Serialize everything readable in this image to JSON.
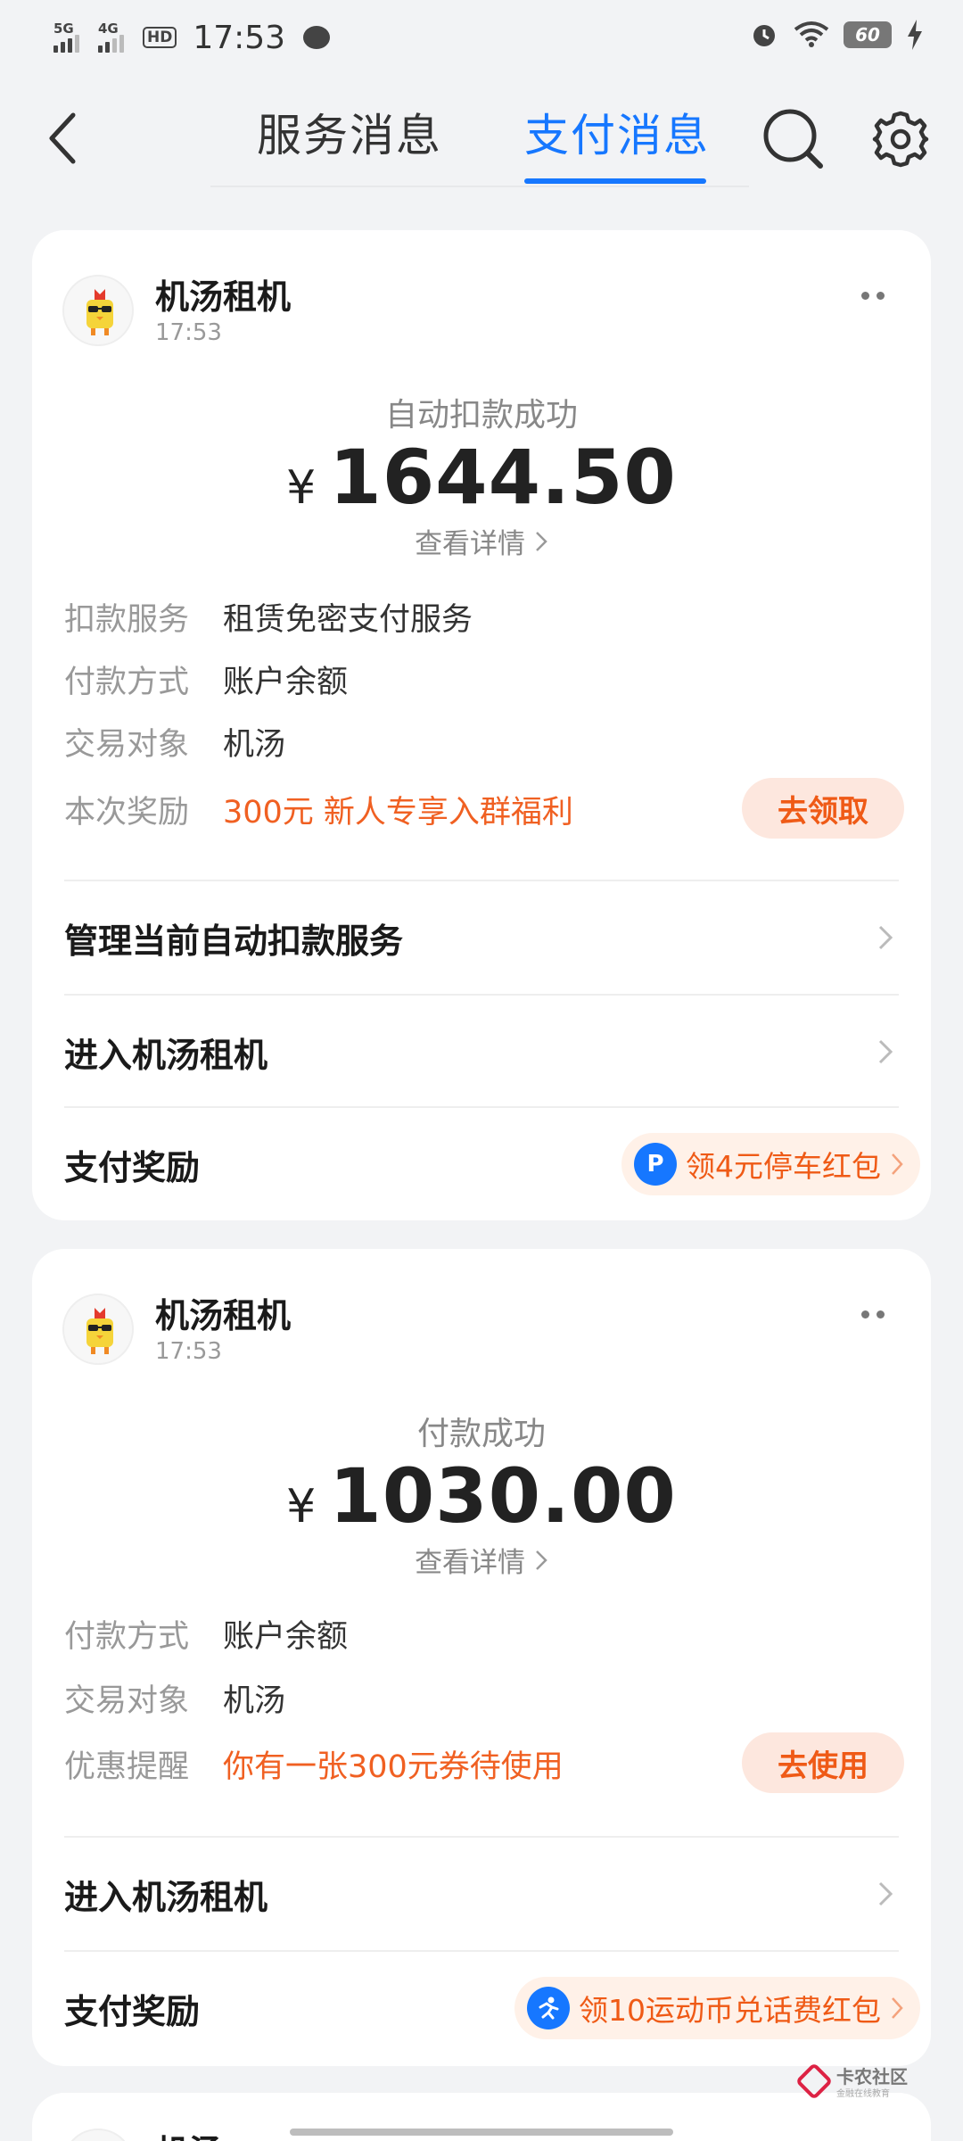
{
  "status_bar": {
    "sim1_label": "5G",
    "sim2_label": "4G",
    "hd_label": "HD",
    "time": "17:53",
    "battery": "60"
  },
  "nav": {
    "tab_service": "服务消息",
    "tab_payment": "支付消息"
  },
  "cards": [
    {
      "merchant": "机汤租机",
      "time": "17:53",
      "title": "自动扣款成功",
      "currency": "¥",
      "amount": "1644.50",
      "detail_link": "查看详情",
      "rows": [
        {
          "label": "扣款服务",
          "value": "租赁免密支付服务"
        },
        {
          "label": "付款方式",
          "value": "账户余额"
        },
        {
          "label": "交易对象",
          "value": "机汤"
        },
        {
          "label": "本次奖励",
          "value": "300元 新人专享入群福利"
        }
      ],
      "action_button": "去领取",
      "links": [
        "管理当前自动扣款服务",
        "进入机汤租机"
      ],
      "reward_label": "支付奖励",
      "reward_text": "领4元停车红包"
    },
    {
      "merchant": "机汤租机",
      "time": "17:53",
      "title": "付款成功",
      "currency": "¥",
      "amount": "1030.00",
      "detail_link": "查看详情",
      "rows": [
        {
          "label": "付款方式",
          "value": "账户余额"
        },
        {
          "label": "交易对象",
          "value": "机汤"
        },
        {
          "label": "优惠提醒",
          "value": "你有一张300元券待使用"
        }
      ],
      "action_button": "去使用",
      "links": [
        "进入机汤租机"
      ],
      "reward_label": "支付奖励",
      "reward_text": "领10运动币兑话费红包"
    },
    {
      "merchant": "机汤"
    }
  ],
  "watermark": {
    "text": "卡农社区",
    "sub": "金融在线教育"
  },
  "colors": {
    "accent": "#1677ff",
    "orange": "#f06022",
    "background": "#f2f3f5"
  }
}
